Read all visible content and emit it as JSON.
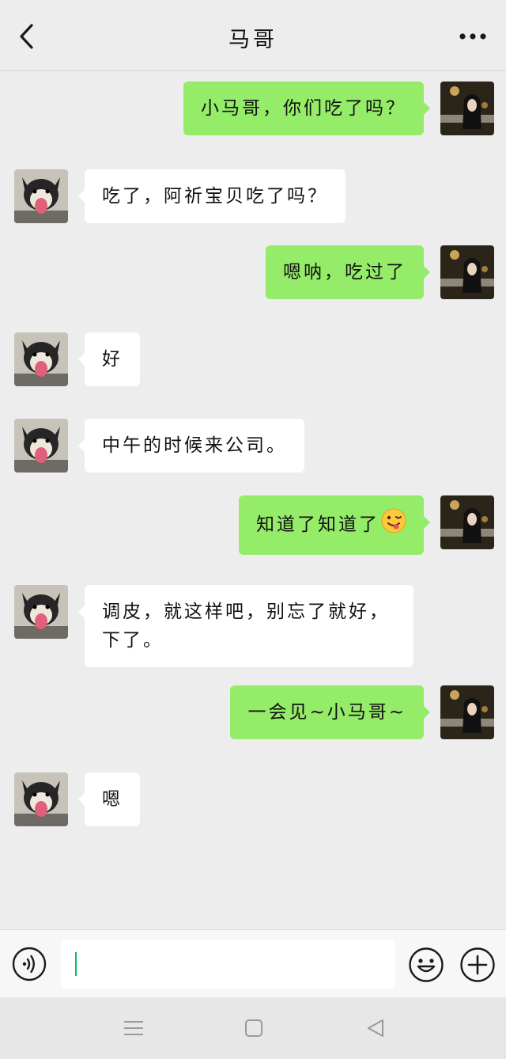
{
  "header": {
    "title": "马哥",
    "back_icon": "chevron-left-icon",
    "more_icon": "ellipsis-icon"
  },
  "messages": [
    {
      "side": "right",
      "text": "小马哥，你们吃了吗？"
    },
    {
      "side": "left",
      "text": "吃了，阿祈宝贝吃了吗？"
    },
    {
      "side": "right",
      "text": "嗯呐，吃过了"
    },
    {
      "side": "left",
      "text": "好"
    },
    {
      "side": "left",
      "text": "中午的时候来公司。"
    },
    {
      "side": "right",
      "text": "知道了知道了",
      "emoji": "winking-tongue-emoji"
    },
    {
      "side": "left",
      "text": "调皮，就这样吧，别忘了就好，下了。"
    },
    {
      "side": "right",
      "text": "一会见~小马哥~"
    },
    {
      "side": "left",
      "text": "嗯"
    }
  ],
  "input": {
    "value": "",
    "voice_icon": "voice-icon",
    "emoji_icon": "smiley-icon",
    "plus_icon": "plus-circle-icon"
  },
  "navbar": {
    "menu_icon": "menu-icon",
    "home_icon": "home-square-icon",
    "back_icon": "back-triangle-icon"
  },
  "colors": {
    "background": "#ededed",
    "my_bubble": "#95ec69",
    "their_bubble": "#ffffff",
    "caret": "#07c160"
  }
}
